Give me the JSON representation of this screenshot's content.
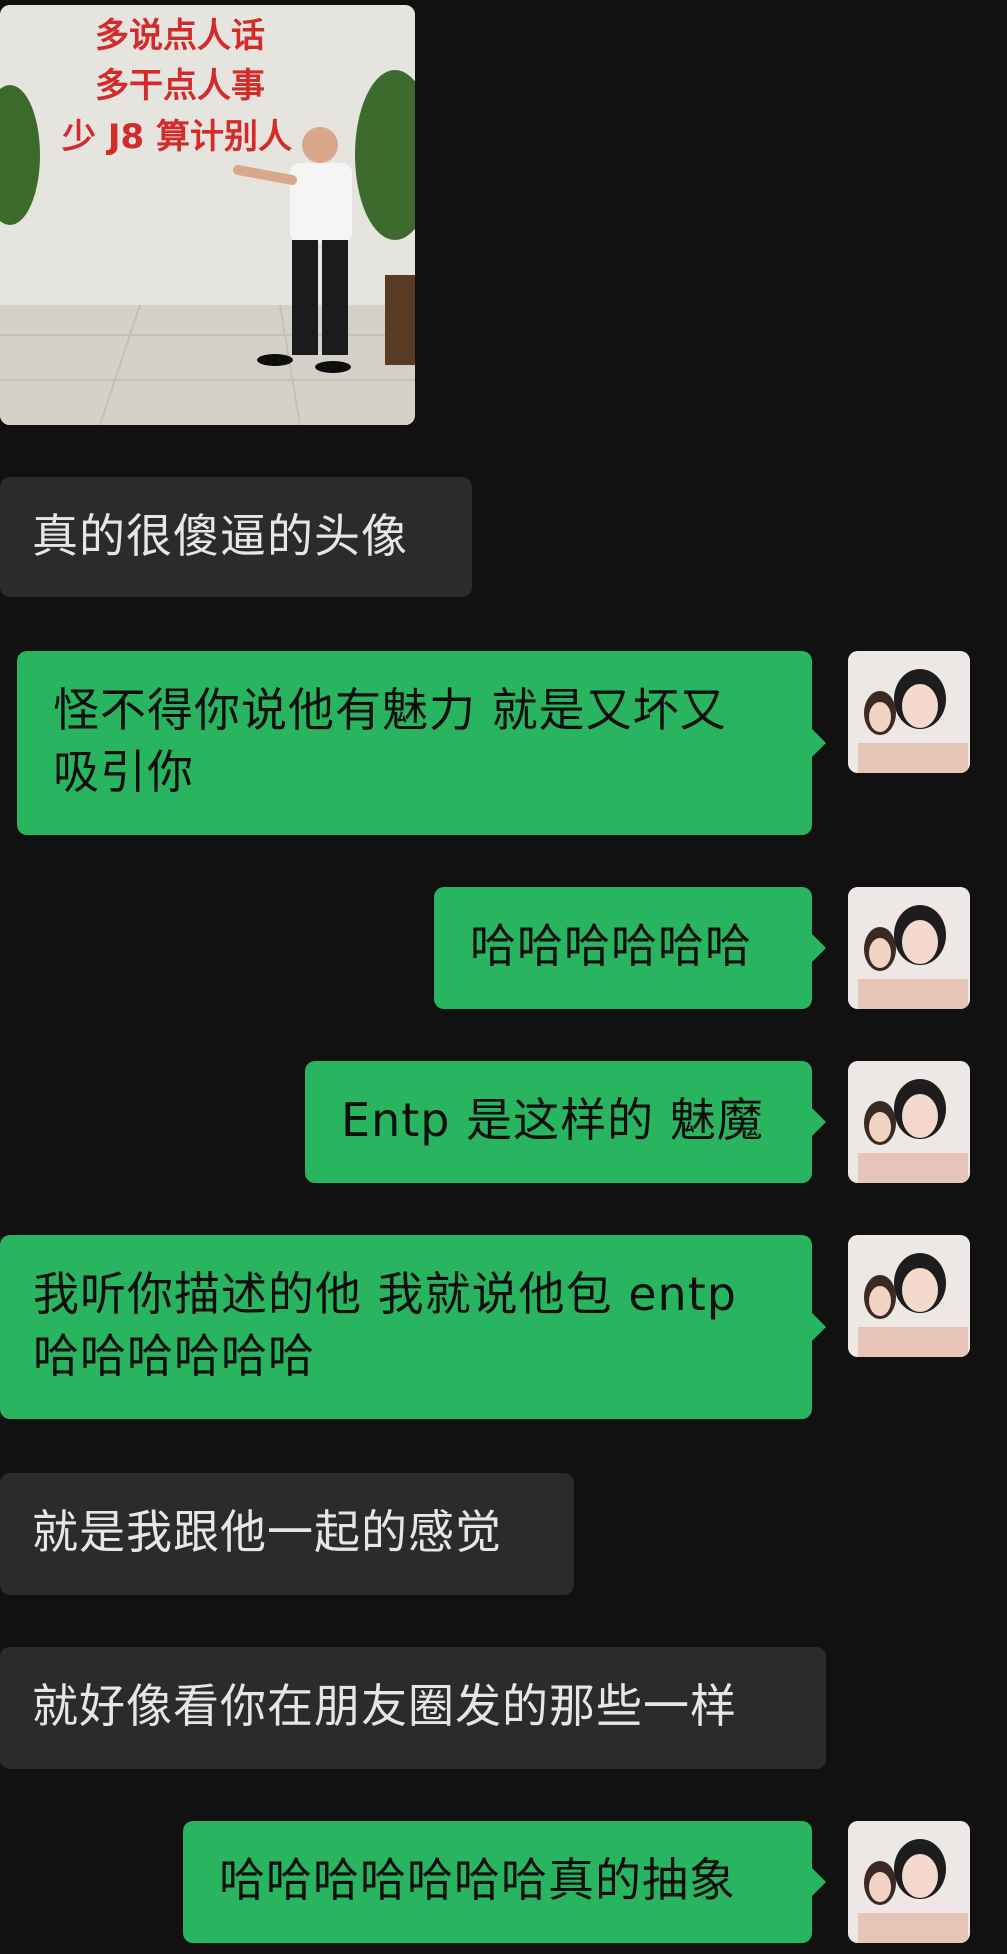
{
  "chat": {
    "photo": {
      "wall_text": [
        "多说点人话",
        "多干点人事",
        "少 J8 算计别人"
      ]
    },
    "messages": [
      {
        "side": "in",
        "text": "真的很傻逼的头像"
      },
      {
        "side": "out",
        "text": "怪不得你说他有魅力 就是又坏又\n吸引你"
      },
      {
        "side": "out",
        "text": "哈哈哈哈哈哈"
      },
      {
        "side": "out",
        "text": "Entp 是这样的 魅魔"
      },
      {
        "side": "out",
        "text": "我听你描述的他 我就说他包 entp\n哈哈哈哈哈哈"
      },
      {
        "side": "in",
        "text": "就是我跟他一起的感觉"
      },
      {
        "side": "in",
        "text": "就好像看你在朋友圈发的那些一样"
      },
      {
        "side": "out",
        "text": "哈哈哈哈哈哈哈真的抽象"
      }
    ]
  },
  "colors": {
    "background": "#111111",
    "incoming_bubble": "#2b2b2b",
    "outgoing_bubble": "#29b560"
  },
  "icons": {
    "avatar": "user-avatar-photo",
    "shared_image": "shared-photo"
  }
}
